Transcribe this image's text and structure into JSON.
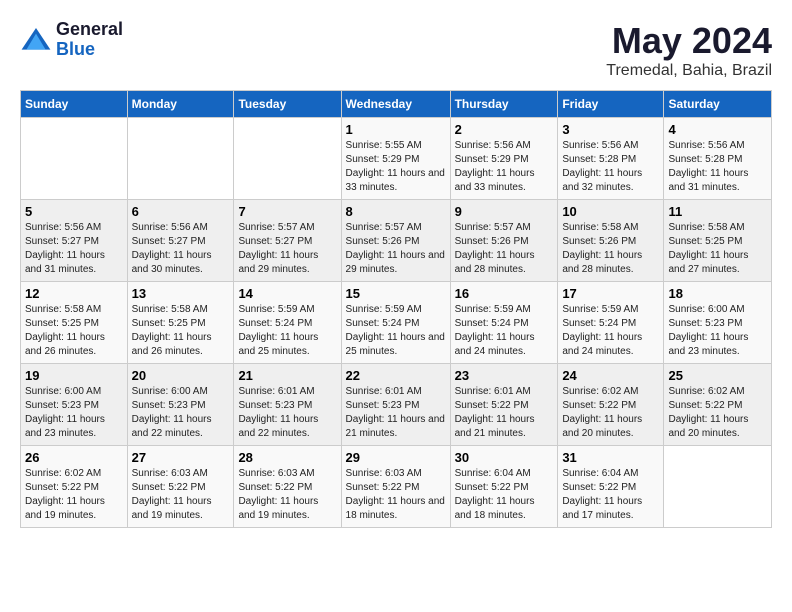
{
  "logo": {
    "general": "General",
    "blue": "Blue"
  },
  "title": "May 2024",
  "subtitle": "Tremedal, Bahia, Brazil",
  "weekdays": [
    "Sunday",
    "Monday",
    "Tuesday",
    "Wednesday",
    "Thursday",
    "Friday",
    "Saturday"
  ],
  "weeks": [
    [
      {
        "day": "",
        "sunrise": "",
        "sunset": "",
        "daylight": ""
      },
      {
        "day": "",
        "sunrise": "",
        "sunset": "",
        "daylight": ""
      },
      {
        "day": "",
        "sunrise": "",
        "sunset": "",
        "daylight": ""
      },
      {
        "day": "1",
        "sunrise": "Sunrise: 5:55 AM",
        "sunset": "Sunset: 5:29 PM",
        "daylight": "Daylight: 11 hours and 33 minutes."
      },
      {
        "day": "2",
        "sunrise": "Sunrise: 5:56 AM",
        "sunset": "Sunset: 5:29 PM",
        "daylight": "Daylight: 11 hours and 33 minutes."
      },
      {
        "day": "3",
        "sunrise": "Sunrise: 5:56 AM",
        "sunset": "Sunset: 5:28 PM",
        "daylight": "Daylight: 11 hours and 32 minutes."
      },
      {
        "day": "4",
        "sunrise": "Sunrise: 5:56 AM",
        "sunset": "Sunset: 5:28 PM",
        "daylight": "Daylight: 11 hours and 31 minutes."
      }
    ],
    [
      {
        "day": "5",
        "sunrise": "Sunrise: 5:56 AM",
        "sunset": "Sunset: 5:27 PM",
        "daylight": "Daylight: 11 hours and 31 minutes."
      },
      {
        "day": "6",
        "sunrise": "Sunrise: 5:56 AM",
        "sunset": "Sunset: 5:27 PM",
        "daylight": "Daylight: 11 hours and 30 minutes."
      },
      {
        "day": "7",
        "sunrise": "Sunrise: 5:57 AM",
        "sunset": "Sunset: 5:27 PM",
        "daylight": "Daylight: 11 hours and 29 minutes."
      },
      {
        "day": "8",
        "sunrise": "Sunrise: 5:57 AM",
        "sunset": "Sunset: 5:26 PM",
        "daylight": "Daylight: 11 hours and 29 minutes."
      },
      {
        "day": "9",
        "sunrise": "Sunrise: 5:57 AM",
        "sunset": "Sunset: 5:26 PM",
        "daylight": "Daylight: 11 hours and 28 minutes."
      },
      {
        "day": "10",
        "sunrise": "Sunrise: 5:58 AM",
        "sunset": "Sunset: 5:26 PM",
        "daylight": "Daylight: 11 hours and 28 minutes."
      },
      {
        "day": "11",
        "sunrise": "Sunrise: 5:58 AM",
        "sunset": "Sunset: 5:25 PM",
        "daylight": "Daylight: 11 hours and 27 minutes."
      }
    ],
    [
      {
        "day": "12",
        "sunrise": "Sunrise: 5:58 AM",
        "sunset": "Sunset: 5:25 PM",
        "daylight": "Daylight: 11 hours and 26 minutes."
      },
      {
        "day": "13",
        "sunrise": "Sunrise: 5:58 AM",
        "sunset": "Sunset: 5:25 PM",
        "daylight": "Daylight: 11 hours and 26 minutes."
      },
      {
        "day": "14",
        "sunrise": "Sunrise: 5:59 AM",
        "sunset": "Sunset: 5:24 PM",
        "daylight": "Daylight: 11 hours and 25 minutes."
      },
      {
        "day": "15",
        "sunrise": "Sunrise: 5:59 AM",
        "sunset": "Sunset: 5:24 PM",
        "daylight": "Daylight: 11 hours and 25 minutes."
      },
      {
        "day": "16",
        "sunrise": "Sunrise: 5:59 AM",
        "sunset": "Sunset: 5:24 PM",
        "daylight": "Daylight: 11 hours and 24 minutes."
      },
      {
        "day": "17",
        "sunrise": "Sunrise: 5:59 AM",
        "sunset": "Sunset: 5:24 PM",
        "daylight": "Daylight: 11 hours and 24 minutes."
      },
      {
        "day": "18",
        "sunrise": "Sunrise: 6:00 AM",
        "sunset": "Sunset: 5:23 PM",
        "daylight": "Daylight: 11 hours and 23 minutes."
      }
    ],
    [
      {
        "day": "19",
        "sunrise": "Sunrise: 6:00 AM",
        "sunset": "Sunset: 5:23 PM",
        "daylight": "Daylight: 11 hours and 23 minutes."
      },
      {
        "day": "20",
        "sunrise": "Sunrise: 6:00 AM",
        "sunset": "Sunset: 5:23 PM",
        "daylight": "Daylight: 11 hours and 22 minutes."
      },
      {
        "day": "21",
        "sunrise": "Sunrise: 6:01 AM",
        "sunset": "Sunset: 5:23 PM",
        "daylight": "Daylight: 11 hours and 22 minutes."
      },
      {
        "day": "22",
        "sunrise": "Sunrise: 6:01 AM",
        "sunset": "Sunset: 5:23 PM",
        "daylight": "Daylight: 11 hours and 21 minutes."
      },
      {
        "day": "23",
        "sunrise": "Sunrise: 6:01 AM",
        "sunset": "Sunset: 5:22 PM",
        "daylight": "Daylight: 11 hours and 21 minutes."
      },
      {
        "day": "24",
        "sunrise": "Sunrise: 6:02 AM",
        "sunset": "Sunset: 5:22 PM",
        "daylight": "Daylight: 11 hours and 20 minutes."
      },
      {
        "day": "25",
        "sunrise": "Sunrise: 6:02 AM",
        "sunset": "Sunset: 5:22 PM",
        "daylight": "Daylight: 11 hours and 20 minutes."
      }
    ],
    [
      {
        "day": "26",
        "sunrise": "Sunrise: 6:02 AM",
        "sunset": "Sunset: 5:22 PM",
        "daylight": "Daylight: 11 hours and 19 minutes."
      },
      {
        "day": "27",
        "sunrise": "Sunrise: 6:03 AM",
        "sunset": "Sunset: 5:22 PM",
        "daylight": "Daylight: 11 hours and 19 minutes."
      },
      {
        "day": "28",
        "sunrise": "Sunrise: 6:03 AM",
        "sunset": "Sunset: 5:22 PM",
        "daylight": "Daylight: 11 hours and 19 minutes."
      },
      {
        "day": "29",
        "sunrise": "Sunrise: 6:03 AM",
        "sunset": "Sunset: 5:22 PM",
        "daylight": "Daylight: 11 hours and 18 minutes."
      },
      {
        "day": "30",
        "sunrise": "Sunrise: 6:04 AM",
        "sunset": "Sunset: 5:22 PM",
        "daylight": "Daylight: 11 hours and 18 minutes."
      },
      {
        "day": "31",
        "sunrise": "Sunrise: 6:04 AM",
        "sunset": "Sunset: 5:22 PM",
        "daylight": "Daylight: 11 hours and 17 minutes."
      },
      {
        "day": "",
        "sunrise": "",
        "sunset": "",
        "daylight": ""
      }
    ]
  ]
}
